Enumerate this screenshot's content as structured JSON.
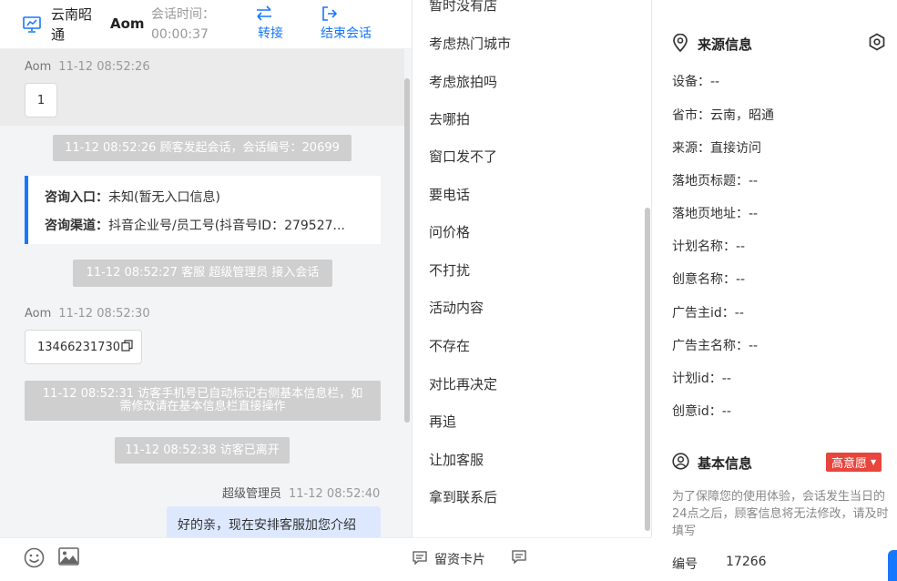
{
  "header": {
    "city": "云南昭通",
    "visitor": "Aom",
    "session_time_label": "会话时间：",
    "session_time": "00:00:37",
    "transfer": "转接",
    "end_session": "结束会话"
  },
  "chat": {
    "msg1": {
      "sender": "Aom",
      "time": "11-12 08:52:26",
      "text": "1"
    },
    "sys1": "11-12 08:52:26 顾客发起会话，会话编号：20699",
    "card": {
      "entry_label": "咨询入口：",
      "entry_value": "未知(暂无入口信息)",
      "channel_label": "咨询渠道：",
      "channel_value": "抖音企业号/员工号(抖音号ID：279527..."
    },
    "sys2": "11-12 08:52:27 客服 超级管理员 接入会话",
    "msg2": {
      "sender": "Aom",
      "time": "11-12 08:52:30",
      "text": "13466231730"
    },
    "sys3": "11-12 08:52:31 访客手机号已自动标记右侧基本信息栏，如需修改请在基本信息栏直接操作",
    "sys4": "11-12 08:52:38 访客已离开",
    "agent": {
      "sender": "超级管理员",
      "time": "11-12 08:52:40",
      "text": "好的亲，现在安排客服加您介绍"
    }
  },
  "footer": {
    "leave_card": "留资卡片",
    "collect_phrases": "收起图文常用语"
  },
  "phrases": [
    "暂时没有店",
    "考虑热门城市",
    "考虑旅拍吗",
    "去哪拍",
    "窗口发不了",
    "要电话",
    "问价格",
    "不打扰",
    "活动内容",
    "不存在",
    "对比再决定",
    "再追",
    "让加客服",
    "拿到联系后"
  ],
  "source": {
    "title": "来源信息",
    "device_label": "设备：",
    "device": "--",
    "province_label": "省市：",
    "province": "云南，昭通",
    "from_label": "来源：",
    "from": "直接访问",
    "landing_title_label": "落地页标题：",
    "landing_title": "--",
    "landing_url_label": "落地页地址：",
    "landing_url": "--",
    "plan_name_label": "计划名称：",
    "plan_name": "--",
    "creative_name_label": "创意名称：",
    "creative_name": "--",
    "advertiser_id_label": "广告主id：",
    "advertiser_id": "--",
    "advertiser_name_label": "广告主名称：",
    "advertiser_name": "--",
    "plan_id_label": "计划id：",
    "plan_id": "--",
    "creative_id_label": "创意id：",
    "creative_id": "--"
  },
  "basic": {
    "title": "基本信息",
    "intent": "高意愿",
    "note": "为了保障您的使用体验，会话发生当日的24点之后，顾客信息将无法修改，请及时填写",
    "id_label": "编号",
    "id_value": "17266"
  },
  "colors": {
    "accent": "#1677ff",
    "intent": "#e8453c",
    "agent_bubble": "#dde8ff"
  }
}
